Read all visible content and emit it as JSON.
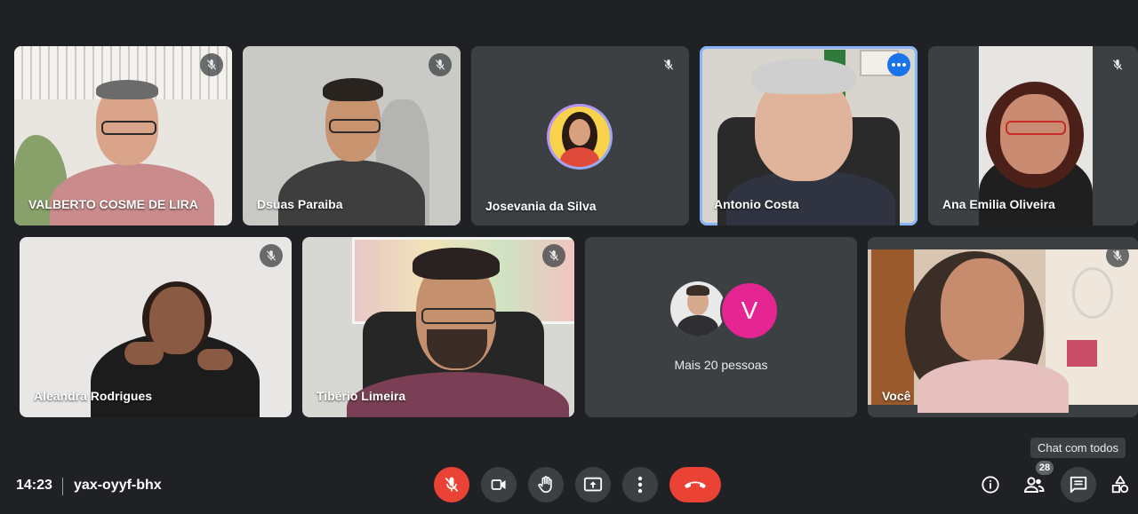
{
  "participants": [
    {
      "name": "VALBERTO COSME DE LIRA",
      "muted": true
    },
    {
      "name": "Dsuas Paraiba",
      "muted": true
    },
    {
      "name": "Josevania da Silva",
      "muted": true
    },
    {
      "name": "Antonio Costa",
      "muted": false,
      "speaking": true
    },
    {
      "name": "Ana Emilia Oliveira",
      "muted": true
    },
    {
      "name": "Aleandra Rodrigues",
      "muted": true
    },
    {
      "name": "Tibério Limeira",
      "muted": true
    },
    {
      "name": "Você",
      "muted": true
    }
  ],
  "more_tile": {
    "avatar_letter": "V",
    "label": "Mais 20 pessoas"
  },
  "meeting": {
    "time": "14:23",
    "code": "yax-oyyf-bhx"
  },
  "controls": [
    "mic-off-icon",
    "camera-icon",
    "raise-hand-icon",
    "present-icon",
    "more-vert-icon",
    "end-call-icon"
  ],
  "right_controls": {
    "participants_count": "28",
    "chat_tooltip": "Chat com todos",
    "icons": [
      "info-icon",
      "people-icon",
      "chat-icon",
      "activities-icon"
    ]
  },
  "colors": {
    "background": "#202124",
    "tile": "#3c4043",
    "danger": "#ea4335",
    "active_border": "#8ab4f8",
    "avatar_v": "#e52592"
  }
}
